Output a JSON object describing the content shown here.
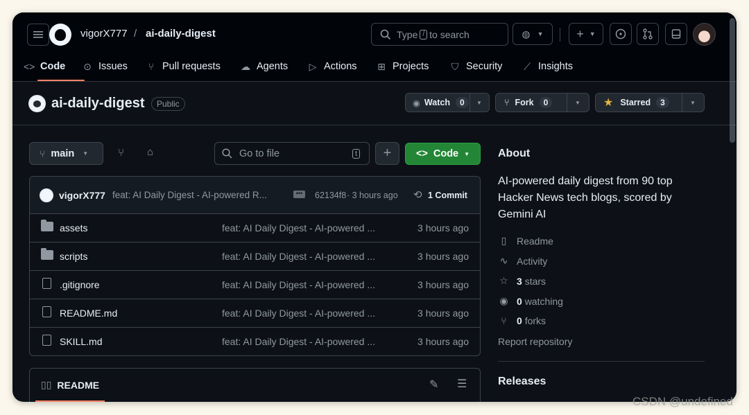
{
  "header": {
    "owner": "vigorX777",
    "separator": "/",
    "repo": "ai-daily-digest",
    "search": {
      "prefix": "Type",
      "key": "/",
      "suffix": "to search"
    }
  },
  "nav": {
    "tabs": [
      {
        "label": "Code",
        "icon": "code-icon",
        "active": true
      },
      {
        "label": "Issues",
        "icon": "issue-icon"
      },
      {
        "label": "Pull requests",
        "icon": "pull-request-icon"
      },
      {
        "label": "Agents",
        "icon": "agents-icon"
      },
      {
        "label": "Actions",
        "icon": "play-icon"
      },
      {
        "label": "Projects",
        "icon": "table-icon"
      },
      {
        "label": "Security",
        "icon": "shield-icon"
      },
      {
        "label": "Insights",
        "icon": "graph-icon"
      }
    ]
  },
  "repo": {
    "name": "ai-daily-digest",
    "visibility": "Public",
    "watch_label": "Watch",
    "watch_count": "0",
    "fork_label": "Fork",
    "fork_count": "0",
    "star_label": "Starred",
    "star_count": "3"
  },
  "toolbar": {
    "branch": "main",
    "goto_placeholder": "Go to file",
    "goto_key": "t",
    "add": "+",
    "code_label": "Code"
  },
  "commit": {
    "author": "vigorX777",
    "message": "feat: AI Daily Digest - AI-powered R...",
    "hash": "62134f8",
    "time": "· 3 hours ago",
    "count": "1 Commit"
  },
  "files": [
    {
      "name": "assets",
      "type": "folder",
      "message": "feat: AI Daily Digest - AI-powered ...",
      "time": "3 hours ago"
    },
    {
      "name": "scripts",
      "type": "folder",
      "message": "feat: AI Daily Digest - AI-powered ...",
      "time": "3 hours ago"
    },
    {
      "name": ".gitignore",
      "type": "file",
      "message": "feat: AI Daily Digest - AI-powered ...",
      "time": "3 hours ago"
    },
    {
      "name": "README.md",
      "type": "file",
      "message": "feat: AI Daily Digest - AI-powered ...",
      "time": "3 hours ago"
    },
    {
      "name": "SKILL.md",
      "type": "file",
      "message": "feat: AI Daily Digest - AI-powered ...",
      "time": "3 hours ago"
    }
  ],
  "readme": {
    "label": "README"
  },
  "about": {
    "title": "About",
    "description": "AI-powered daily digest from 90 top Hacker News tech blogs, scored by Gemini AI",
    "readme": "Readme",
    "activity": "Activity",
    "stars_num": "3",
    "stars_label": "stars",
    "watching_num": "0",
    "watching_label": "watching",
    "forks_num": "0",
    "forks_label": "forks",
    "report": "Report repository"
  },
  "releases": {
    "title": "Releases"
  },
  "watermark": "CSDN @undefined",
  "colors": {
    "accent": "#f78166",
    "green": "#238636",
    "star": "#e3b341",
    "bg": "#0d1117"
  }
}
